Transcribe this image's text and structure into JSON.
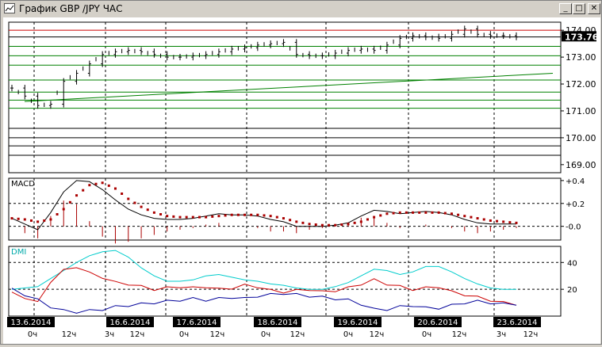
{
  "window": {
    "title": "График GBP /JPY  ЧАС",
    "minimize_label": "_",
    "maximize_label": "□",
    "close_label": "✕",
    "icon": "chart-window-icon"
  },
  "chart_data": [
    {
      "type": "candlestick",
      "title": "График GBP /JPY  ЧАС",
      "ylim": [
        168.7,
        174.3
      ],
      "y_ticks": [
        "174.00",
        "173.00",
        "172.00",
        "171.00",
        "170.00",
        "169.00"
      ],
      "current_price_label": "173.76",
      "x_date_labels": [
        "13.6.2014",
        "16.6.2014",
        "17.6.2014",
        "18.6.2014",
        "19.6.2014",
        "20.6.2014",
        "23.6.2014"
      ],
      "x_hour_labels": [
        "0ч",
        "12ч",
        "3ч",
        "12ч",
        "0ч",
        "12ч",
        "0ч",
        "12ч",
        "0ч",
        "12ч",
        "0ч",
        "12ч",
        "3ч",
        "12ч"
      ],
      "close_series": [
        171.85,
        171.55,
        171.2,
        171.25,
        172.1,
        172.4,
        172.75,
        173.1,
        173.2,
        173.25,
        173.2,
        173.1,
        173.0,
        173.0,
        173.05,
        173.1,
        173.2,
        173.3,
        173.35,
        173.45,
        173.5,
        173.55,
        173.1,
        173.05,
        173.05,
        173.15,
        173.25,
        173.3,
        173.25,
        173.45,
        173.7,
        173.8,
        173.75,
        173.7,
        173.85,
        174.05,
        173.85,
        173.8,
        173.8,
        173.75
      ],
      "support_resistance_levels": [
        174.0,
        173.75,
        173.4,
        173.05,
        172.7,
        172.15,
        171.7,
        171.4,
        171.1,
        170.35,
        170.0,
        169.7,
        169.35
      ],
      "trendline": [
        171.35,
        172.4
      ]
    },
    {
      "type": "line",
      "title": "MACD",
      "ylim": [
        -0.12,
        0.42
      ],
      "y_ticks": [
        "+0.4",
        "+0.2",
        "-0.0"
      ],
      "series": [
        {
          "name": "macd",
          "color": "#000000",
          "values": [
            0.07,
            0.02,
            -0.03,
            0.12,
            0.3,
            0.4,
            0.39,
            0.32,
            0.23,
            0.15,
            0.1,
            0.07,
            0.06,
            0.06,
            0.07,
            0.09,
            0.11,
            0.1,
            0.1,
            0.09,
            0.06,
            0.04,
            0.0,
            0.0,
            0.0,
            0.01,
            0.03,
            0.09,
            0.14,
            0.13,
            0.11,
            0.12,
            0.13,
            0.12,
            0.1,
            0.06,
            0.03,
            0.02,
            0.02,
            0.02
          ]
        },
        {
          "name": "signal",
          "color": "#aa0000",
          "values": [
            0.07,
            0.06,
            0.04,
            0.06,
            0.15,
            0.27,
            0.36,
            0.38,
            0.33,
            0.24,
            0.17,
            0.12,
            0.09,
            0.08,
            0.08,
            0.08,
            0.09,
            0.1,
            0.1,
            0.1,
            0.09,
            0.07,
            0.04,
            0.02,
            0.01,
            0.01,
            0.02,
            0.04,
            0.08,
            0.11,
            0.12,
            0.12,
            0.12,
            0.12,
            0.11,
            0.09,
            0.07,
            0.05,
            0.04,
            0.03
          ]
        }
      ]
    },
    {
      "type": "line",
      "title": "DMI",
      "ylim": [
        0,
        52
      ],
      "y_ticks": [
        "40",
        "20"
      ],
      "series": [
        {
          "name": "adx",
          "color": "#00cccc",
          "values": [
            20,
            21,
            22,
            28,
            34,
            40,
            45,
            48,
            49,
            44,
            36,
            30,
            26,
            26,
            27,
            30,
            31,
            29,
            27,
            26,
            24,
            23,
            21,
            20,
            20,
            22,
            25,
            30,
            35,
            34,
            31,
            33,
            37,
            37,
            33,
            28,
            24,
            21,
            20,
            20
          ]
        },
        {
          "name": "+di",
          "color": "#cc0000",
          "values": [
            17,
            14,
            10,
            26,
            34,
            37,
            32,
            29,
            25,
            24,
            22,
            20,
            21,
            22,
            21,
            22,
            20,
            21,
            23,
            22,
            19,
            18,
            19,
            20,
            18,
            19,
            21,
            24,
            27,
            24,
            22,
            20,
            21,
            22,
            18,
            16,
            14,
            12,
            10,
            9
          ]
        },
        {
          "name": "-di",
          "color": "#000099",
          "values": [
            20,
            16,
            12,
            7,
            4,
            3,
            4,
            5,
            7,
            8,
            9,
            10,
            11,
            12,
            13,
            12,
            13,
            14,
            13,
            15,
            16,
            17,
            16,
            15,
            14,
            13,
            12,
            9,
            5,
            5,
            7,
            8,
            6,
            6,
            8,
            10,
            11,
            10,
            9,
            9
          ]
        }
      ]
    }
  ]
}
